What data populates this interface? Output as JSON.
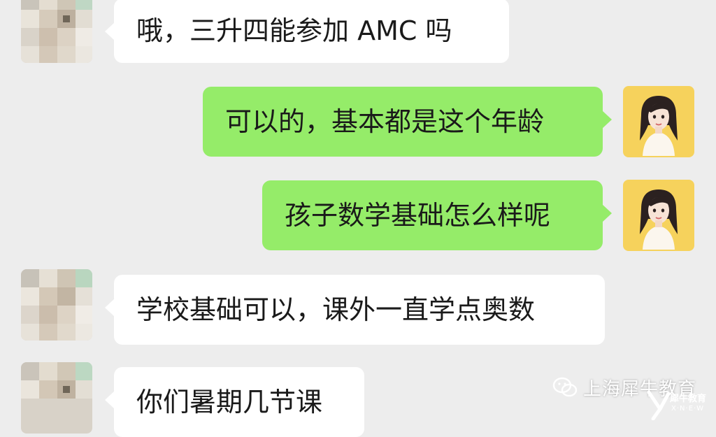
{
  "chat": {
    "messages": [
      {
        "side": "in",
        "text": "哦，三升四能参加 AMC 吗"
      },
      {
        "side": "out",
        "text": "可以的，基本都是这个年龄"
      },
      {
        "side": "out",
        "text": "孩子数学基础怎么样呢"
      },
      {
        "side": "in",
        "text": "学校基础可以，课外一直学点奥数"
      },
      {
        "side": "in",
        "text": "你们暑期几节课"
      }
    ]
  },
  "watermark": {
    "text": "上海犀牛教育",
    "icon": "wechat-icon",
    "logo_small_text": "犀牛教育",
    "logo_sub_text": "X·N·E·W"
  },
  "colors": {
    "background": "#ededed",
    "incoming_bubble": "#ffffff",
    "outgoing_bubble": "#95ec69",
    "agent_avatar_bg": "#f6d25c"
  }
}
